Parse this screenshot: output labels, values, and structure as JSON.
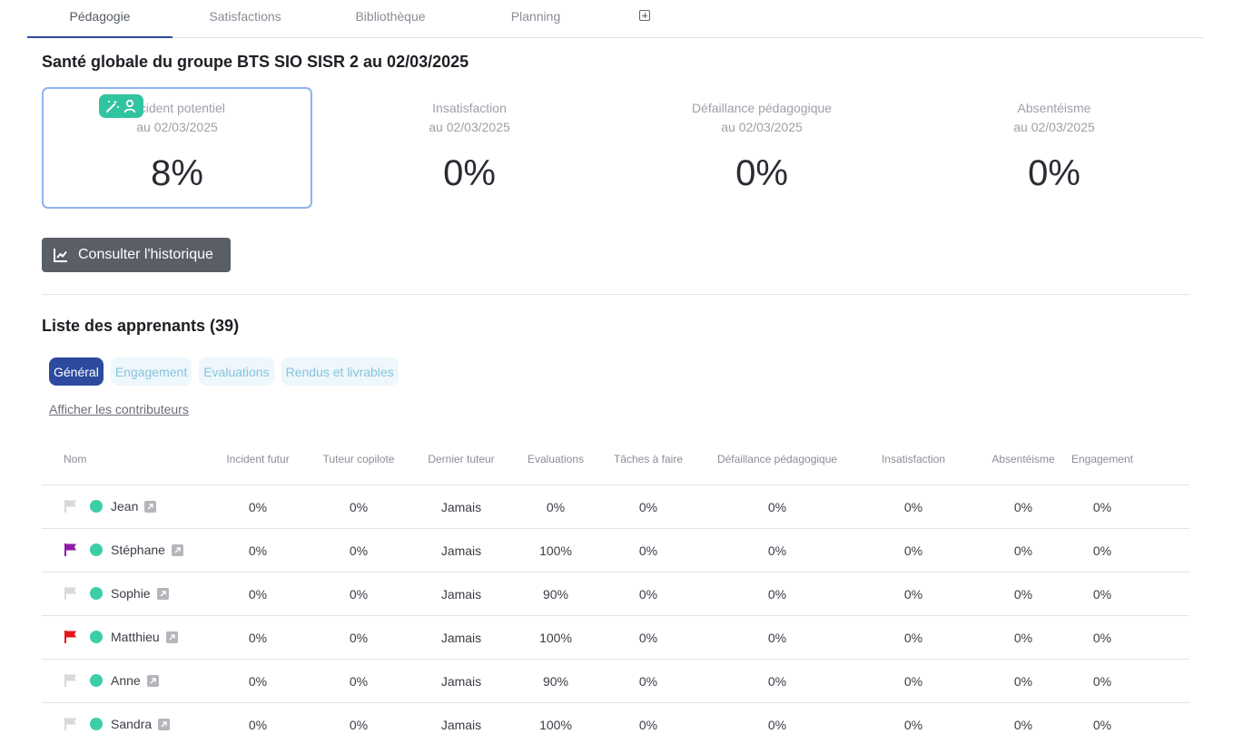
{
  "tabs": [
    {
      "label": "Pédagogie",
      "active": true
    },
    {
      "label": "Satisfactions",
      "active": false
    },
    {
      "label": "Bibliothèque",
      "active": false
    },
    {
      "label": "Planning",
      "active": false
    }
  ],
  "health": {
    "title": "Santé globale du groupe BTS SIO SISR 2 au 02/03/2025",
    "cards": [
      {
        "label": "Incident potentiel",
        "date": "au 02/03/2025",
        "value": "8%"
      },
      {
        "label": "Insatisfaction",
        "date": "au 02/03/2025",
        "value": "0%"
      },
      {
        "label": "Défaillance pédagogique",
        "date": "au 02/03/2025",
        "value": "0%"
      },
      {
        "label": "Absentéisme",
        "date": "au 02/03/2025",
        "value": "0%"
      }
    ],
    "badge_color": "#31c4a0",
    "history_button": "Consulter l'historique"
  },
  "learners": {
    "title": "Liste des apprenants (39)",
    "filters": [
      "Général",
      "Engagement",
      "Evaluations",
      "Rendus et livrables"
    ],
    "active_filter": "Général",
    "contributors_link": "Afficher les contributeurs",
    "columns": [
      "Nom",
      "Incident futur",
      "Tuteur copilote",
      "Dernier tuteur",
      "Evaluations",
      "Tâches à faire",
      "Défaillance pédagogique",
      "Insatisfaction",
      "Absentéisme",
      "Engagement"
    ],
    "rows": [
      {
        "name": "Jean",
        "flag": "#d9d9d9",
        "values": [
          "0%",
          "0%",
          "Jamais",
          "0%",
          "0%",
          "0%",
          "0%",
          "0%",
          "0%"
        ]
      },
      {
        "name": "Stéphane",
        "flag": "#8e1ba8",
        "values": [
          "0%",
          "0%",
          "Jamais",
          "100%",
          "0%",
          "0%",
          "0%",
          "0%",
          "0%"
        ]
      },
      {
        "name": "Sophie",
        "flag": "#d9d9d9",
        "values": [
          "0%",
          "0%",
          "Jamais",
          "90%",
          "0%",
          "0%",
          "0%",
          "0%",
          "0%"
        ]
      },
      {
        "name": "Matthieu",
        "flag": "#e8151b",
        "values": [
          "0%",
          "0%",
          "Jamais",
          "100%",
          "0%",
          "0%",
          "0%",
          "0%",
          "0%"
        ]
      },
      {
        "name": "Anne",
        "flag": "#d9d9d9",
        "values": [
          "0%",
          "0%",
          "Jamais",
          "90%",
          "0%",
          "0%",
          "0%",
          "0%",
          "0%"
        ]
      },
      {
        "name": "Sandra",
        "flag": "#d9d9d9",
        "values": [
          "0%",
          "0%",
          "Jamais",
          "100%",
          "0%",
          "0%",
          "0%",
          "0%",
          "0%"
        ]
      }
    ]
  },
  "colors": {
    "accent": "#2e4a9e",
    "status_dot": "#3ccfa7",
    "selected_border": "#8fb2ee"
  }
}
